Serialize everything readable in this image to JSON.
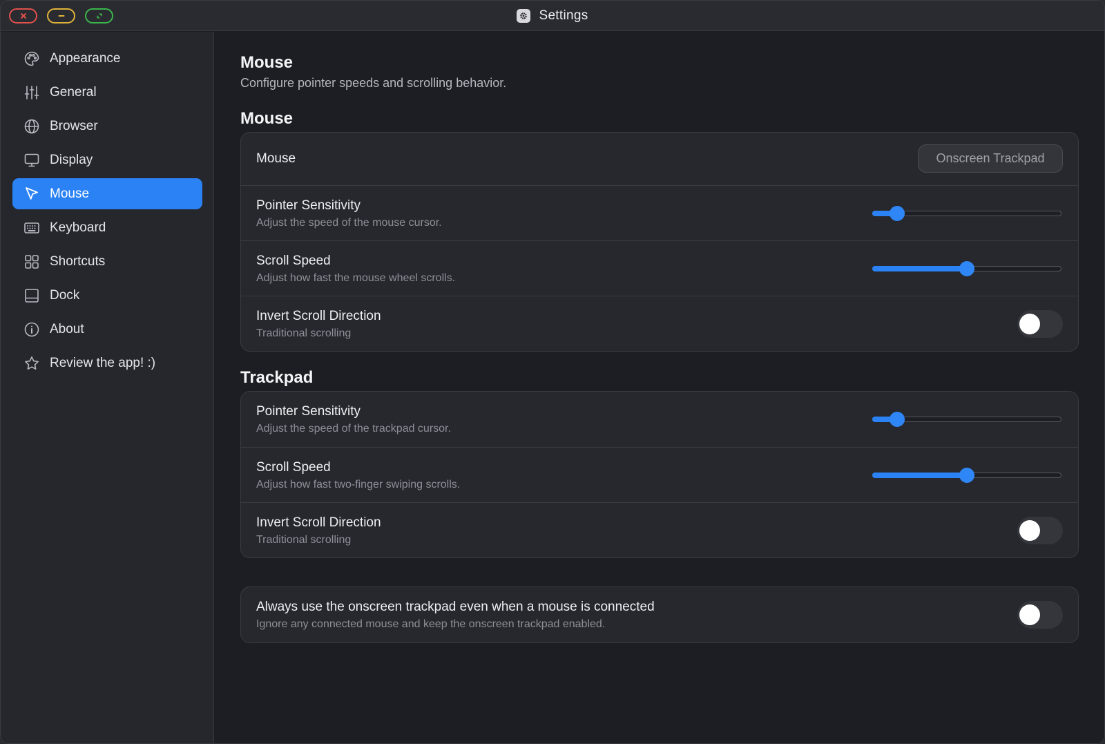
{
  "window": {
    "title": "Settings"
  },
  "sidebar": {
    "items": [
      {
        "label": "Appearance",
        "icon": "palette-icon"
      },
      {
        "label": "General",
        "icon": "sliders-icon"
      },
      {
        "label": "Browser",
        "icon": "globe-icon"
      },
      {
        "label": "Display",
        "icon": "monitor-icon"
      },
      {
        "label": "Mouse",
        "icon": "cursor-icon",
        "active": true
      },
      {
        "label": "Keyboard",
        "icon": "keyboard-icon"
      },
      {
        "label": "Shortcuts",
        "icon": "grid-icon"
      },
      {
        "label": "Dock",
        "icon": "dock-icon"
      },
      {
        "label": "About",
        "icon": "info-icon"
      },
      {
        "label": "Review the app! :)",
        "icon": "star-icon"
      }
    ]
  },
  "page": {
    "title": "Mouse",
    "subtitle": "Configure pointer speeds and scrolling behavior."
  },
  "mouse_section": {
    "title": "Mouse",
    "device_label": "Mouse",
    "device_button": "Onscreen Trackpad",
    "pointer": {
      "label": "Pointer Sensitivity",
      "desc": "Adjust the speed of the mouse cursor.",
      "value": 0.13
    },
    "scroll": {
      "label": "Scroll Speed",
      "desc": "Adjust how fast the mouse wheel scrolls.",
      "value": 0.5
    },
    "invert": {
      "label": "Invert Scroll Direction",
      "desc": "Traditional scrolling",
      "on": false
    }
  },
  "trackpad_section": {
    "title": "Trackpad",
    "pointer": {
      "label": "Pointer Sensitivity",
      "desc": "Adjust the speed of the trackpad cursor.",
      "value": 0.13
    },
    "scroll": {
      "label": "Scroll Speed",
      "desc": "Adjust how fast two-finger swiping scrolls.",
      "value": 0.5
    },
    "invert": {
      "label": "Invert Scroll Direction",
      "desc": "Traditional scrolling",
      "on": false
    }
  },
  "always": {
    "label": "Always use the onscreen trackpad even when a mouse is connected",
    "desc": "Ignore any connected mouse and keep the onscreen trackpad enabled.",
    "on": false
  },
  "colors": {
    "accent": "#2a82f4",
    "background": "#1d1e23",
    "card": "#27282e"
  }
}
